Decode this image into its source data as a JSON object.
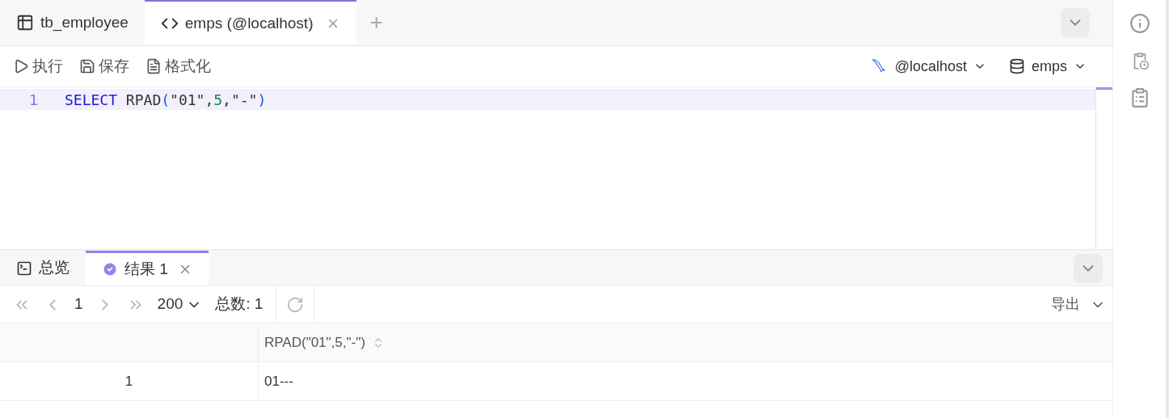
{
  "editor_tabs": [
    {
      "kind": "table",
      "label": "tb_employee",
      "selected": false,
      "closable": false
    },
    {
      "kind": "query",
      "label": "emps (@localhost)",
      "selected": true,
      "closable": true
    }
  ],
  "new_tab": "+",
  "toolbar": [
    {
      "kind": "run",
      "label": "执行"
    },
    {
      "kind": "save",
      "label": "保存"
    },
    {
      "kind": "format",
      "label": "格式化"
    }
  ],
  "connection": {
    "host": "@localhost",
    "database": "emps"
  },
  "editor": {
    "lines": [
      {
        "number": "1",
        "current": true,
        "tokens": [
          {
            "kind": "keyword",
            "text": "SELECT"
          },
          {
            "kind": "plain",
            "text": " RPAD"
          },
          {
            "kind": "paren",
            "text": "("
          },
          {
            "kind": "plain",
            "text": "\"01\","
          },
          {
            "kind": "number",
            "text": "5"
          },
          {
            "kind": "plain",
            "text": ",\"-\""
          },
          {
            "kind": "paren",
            "text": ")"
          }
        ]
      }
    ]
  },
  "result_tabs": [
    {
      "kind": "overview",
      "label": "总览",
      "selected": false,
      "closable": false
    },
    {
      "kind": "result",
      "label": "结果 1",
      "selected": true,
      "closable": true
    }
  ],
  "pagination": {
    "page": "1",
    "page_size": "200",
    "total_label": "总数:",
    "total": "1",
    "export": "导出"
  },
  "table": {
    "columns": [
      "",
      "RPAD(\"01\",5,\"-\")"
    ],
    "rows": [
      {
        "index": "1",
        "cells": [
          "01---"
        ]
      }
    ]
  }
}
